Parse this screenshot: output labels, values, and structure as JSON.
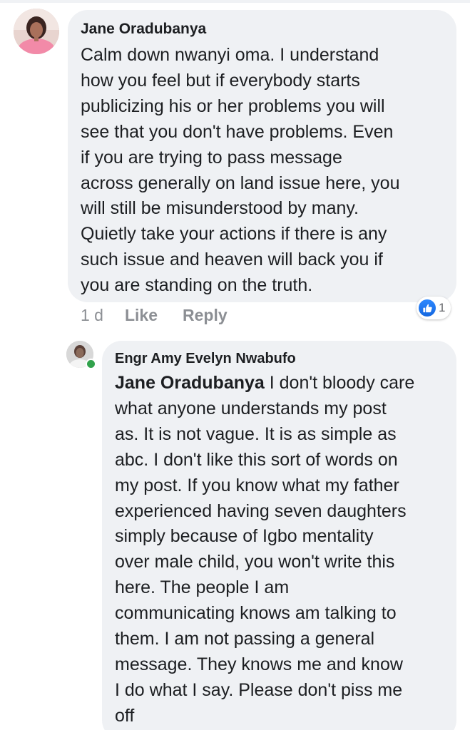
{
  "comment1": {
    "author": "Jane Oradubanya",
    "text": "Calm down nwanyi oma. I understand\nhow you feel but if everybody starts\npublicizing his or her problems you will\nsee that you don't have problems. Even\nif you are trying to pass message\nacross generally on land issue here, you\nwill still be misunderstood by many.\nQuietly take your actions if there is any\nsuch issue and heaven will back you if\nyou are standing on the truth.",
    "time": "1 d",
    "like_label": "Like",
    "reply_label": "Reply",
    "reaction_count": "1",
    "reaction_icon": "thumbs-up-icon"
  },
  "comment2": {
    "author": "Engr Amy Evelyn Nwabufo",
    "mention": "Jane Oradubanya",
    "text": " I don't bloody care\nwhat anyone understands my post\nas. It is not vague. It is as simple as\nabc. I don't like this sort of words on\nmy post. If you know what my father\nexperienced having seven daughters\nsimply because of Igbo mentality\nover male child, you won't write this\nhere. The people I am\ncommunicating knows am talking to\nthem. I am not passing a general\nmessage. They knows me and know\nI do what I say. Please don't piss me\noff",
    "online_status_color": "#31a24c"
  },
  "colors": {
    "bubble": "#eff1f4",
    "meta_text": "#8c8f94",
    "like_blue": "#1877f2"
  }
}
